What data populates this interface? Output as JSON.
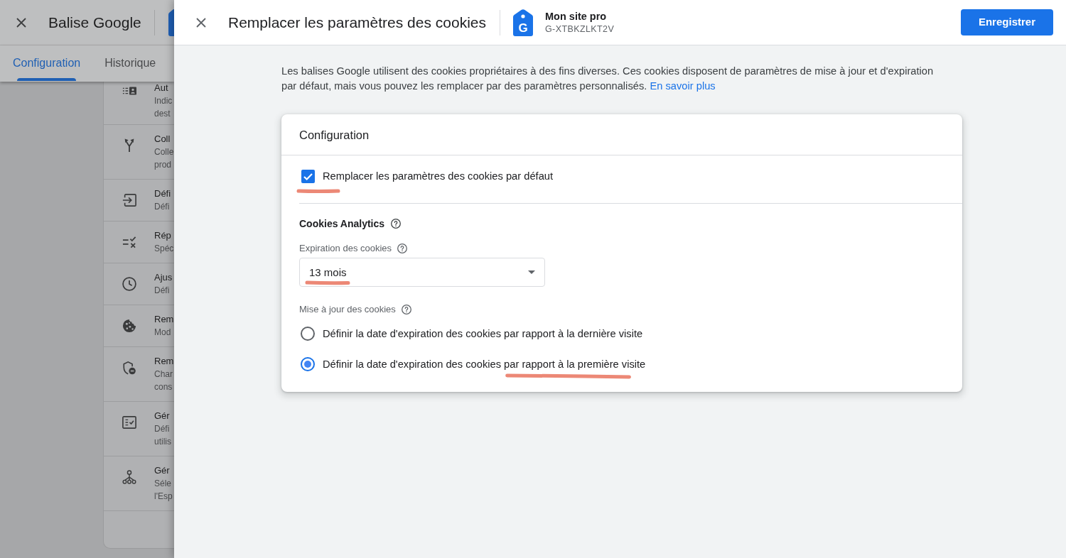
{
  "background_page": {
    "title": "Balise Google",
    "tabs": [
      {
        "label": "Configuration",
        "selected": true
      },
      {
        "label": "Historique",
        "selected": false
      }
    ],
    "settings_list": [
      {
        "title": "Aut",
        "description_lines": [
          "Indic",
          "dest"
        ]
      },
      {
        "title": "Coll",
        "description_lines": [
          "Colle",
          "prod"
        ]
      },
      {
        "title": "Défi",
        "description_lines": [
          "Défi"
        ]
      },
      {
        "title": "Rép",
        "description_lines": [
          "Spéc"
        ]
      },
      {
        "title": "Ajus",
        "description_lines": [
          "Défi"
        ]
      },
      {
        "title": "Rem",
        "description_lines": [
          "Mod"
        ]
      },
      {
        "title": "Rem",
        "description_lines": [
          "Char",
          "cons"
        ]
      },
      {
        "title": "Gér",
        "description_lines": [
          "Défi",
          "utilis"
        ]
      },
      {
        "title": "Gér",
        "description_lines": [
          "Séle",
          "l'Esp"
        ]
      }
    ]
  },
  "drawer": {
    "title": "Remplacer les paramètres des cookies",
    "tag": {
      "logo_letter": "G",
      "name": "Mon site pro",
      "id": "G-XTBKZLKT2V"
    },
    "save_button": "Enregistrer",
    "intro": {
      "text": "Les balises Google utilisent des cookies propriétaires à des fins diverses. Ces cookies disposent de paramètres de mise à jour et d'expiration par défaut, mais vous pouvez les remplacer par des paramètres personnalisés.",
      "link": "En savoir plus"
    },
    "card": {
      "title": "Configuration",
      "override_checkbox": {
        "label": "Remplacer les paramètres des cookies par défaut",
        "checked": true,
        "annotated": true
      },
      "section_title": "Cookies Analytics",
      "expiration": {
        "label": "Expiration des cookies",
        "value": "13 mois",
        "annotated": true
      },
      "update": {
        "label": "Mise à jour des cookies",
        "options": [
          {
            "label": "Définir la date d'expiration des cookies par rapport à la dernière visite",
            "selected": false,
            "annotated": false
          },
          {
            "label": "Définir la date d'expiration des cookies par rapport à la première visite",
            "selected": true,
            "annotated": true
          }
        ]
      }
    }
  }
}
